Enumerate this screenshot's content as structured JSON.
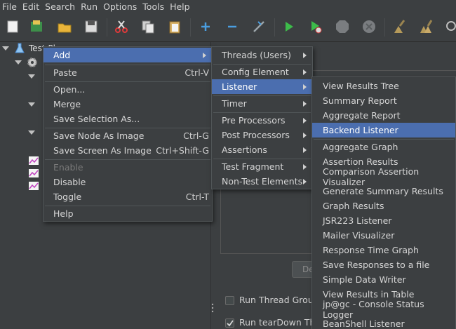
{
  "menubar": [
    "File",
    "Edit",
    "Search",
    "Run",
    "Options",
    "Tools",
    "Help"
  ],
  "toolbar_icons": [
    "new-icon",
    "templates-icon",
    "open-icon",
    "save-icon",
    "cut-icon",
    "copy-icon",
    "paste-icon",
    "expand-icon",
    "collapse-icon",
    "toggle-icon",
    "start-icon",
    "start-no-pauses-icon",
    "stop-icon",
    "shutdown-icon",
    "clear-icon",
    "clear-all-icon",
    "search-icon"
  ],
  "tree": {
    "root_label": "Test Plan"
  },
  "context_menu": {
    "add": "Add",
    "paste": "Paste",
    "paste_shortcut": "Ctrl-V",
    "open": "Open...",
    "merge": "Merge",
    "save_selection_as": "Save Selection As...",
    "save_node_as_image": "Save Node As Image",
    "save_node_as_image_shortcut": "Ctrl-G",
    "save_screen_as_image": "Save Screen As Image",
    "save_screen_as_image_shortcut": "Ctrl+Shift-G",
    "enable": "Enable",
    "disable": "Disable",
    "toggle": "Toggle",
    "toggle_shortcut": "Ctrl-T",
    "help": "Help"
  },
  "add_submenu": {
    "threads": "Threads (Users)",
    "config_element": "Config Element",
    "listener": "Listener",
    "timer": "Timer",
    "pre_processors": "Pre Processors",
    "post_processors": "Post Processors",
    "assertions": "Assertions",
    "test_fragment": "Test Fragment",
    "non_test_elements": "Non-Test Elements"
  },
  "listener_submenu": [
    "View Results Tree",
    "Summary Report",
    "Aggregate Report",
    "Backend Listener",
    "Aggregate Graph",
    "Assertion Results",
    "Comparison Assertion Visualizer",
    "Generate Summary Results",
    "Graph Results",
    "JSR223 Listener",
    "Mailer Visualizer",
    "Response Time Graph",
    "Save Responses to a file",
    "Simple Data Writer",
    "View Results in Table",
    "jp@gc - Console Status Logger",
    "BeanShell Listener"
  ],
  "right_panel": {
    "button_fragment": "De",
    "run_thread_groups": "Run Thread Group",
    "run_teardown": "Run tearDown Thre"
  },
  "colors": {
    "background": "#3c3f41",
    "selection": "#4b6eaf"
  }
}
